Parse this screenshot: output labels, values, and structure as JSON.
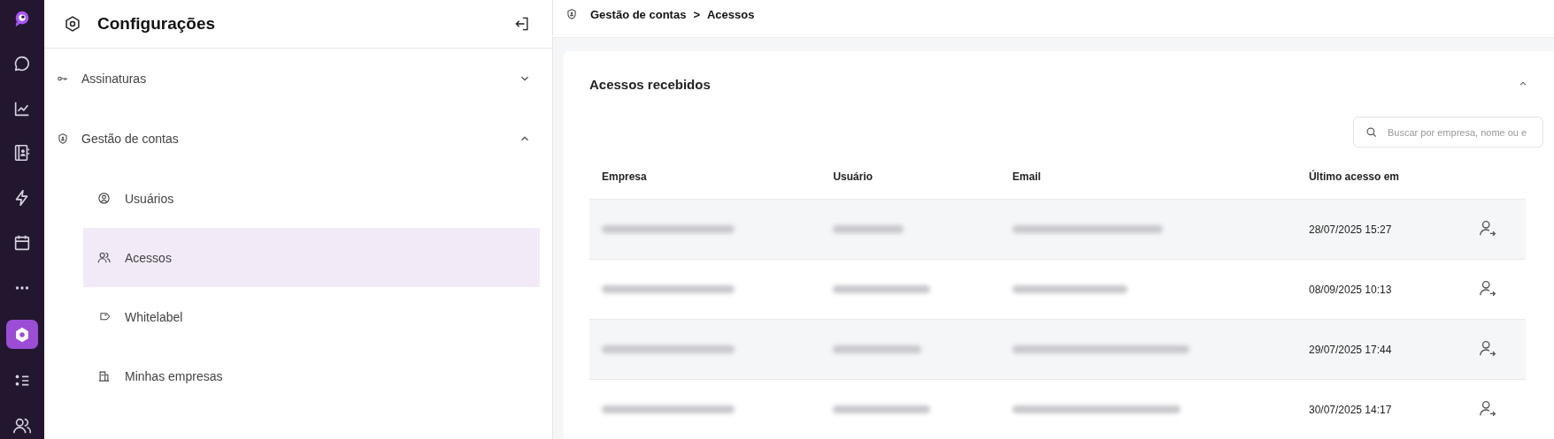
{
  "rail": [
    {
      "selected": false
    },
    {
      "selected": false
    },
    {
      "selected": false
    },
    {
      "selected": false
    },
    {
      "selected": false
    },
    {
      "selected": false
    },
    {
      "selected": false
    },
    {
      "selected": true
    },
    {
      "selected": false
    },
    {
      "selected": false
    }
  ],
  "sidebar": {
    "title": "Configurações",
    "sections": [
      {
        "label": "Assinaturas",
        "expanded": false
      },
      {
        "label": "Gestão de contas",
        "expanded": true,
        "children": [
          {
            "label": "Usuários",
            "selected": false
          },
          {
            "label": "Acessos",
            "selected": true
          },
          {
            "label": "Whitelabel",
            "selected": false
          },
          {
            "label": "Minhas empresas",
            "selected": false
          }
        ]
      }
    ]
  },
  "breadcrumb": {
    "parent": "Gestão de contas",
    "separator": ">",
    "current": "Acessos"
  },
  "card": {
    "title": "Acessos recebidos",
    "expanded": true,
    "search": {
      "placeholder": "Buscar por empresa, nome ou e"
    },
    "table": {
      "columns": [
        "Empresa",
        "Usuário",
        "Email",
        "Último acesso em"
      ],
      "rows": [
        {
          "last_access": "28/07/2025 15:27"
        },
        {
          "last_access": "08/09/2025 10:13"
        },
        {
          "last_access": "29/07/2025 17:44"
        },
        {
          "last_access": "30/07/2025 14:17"
        }
      ]
    }
  }
}
